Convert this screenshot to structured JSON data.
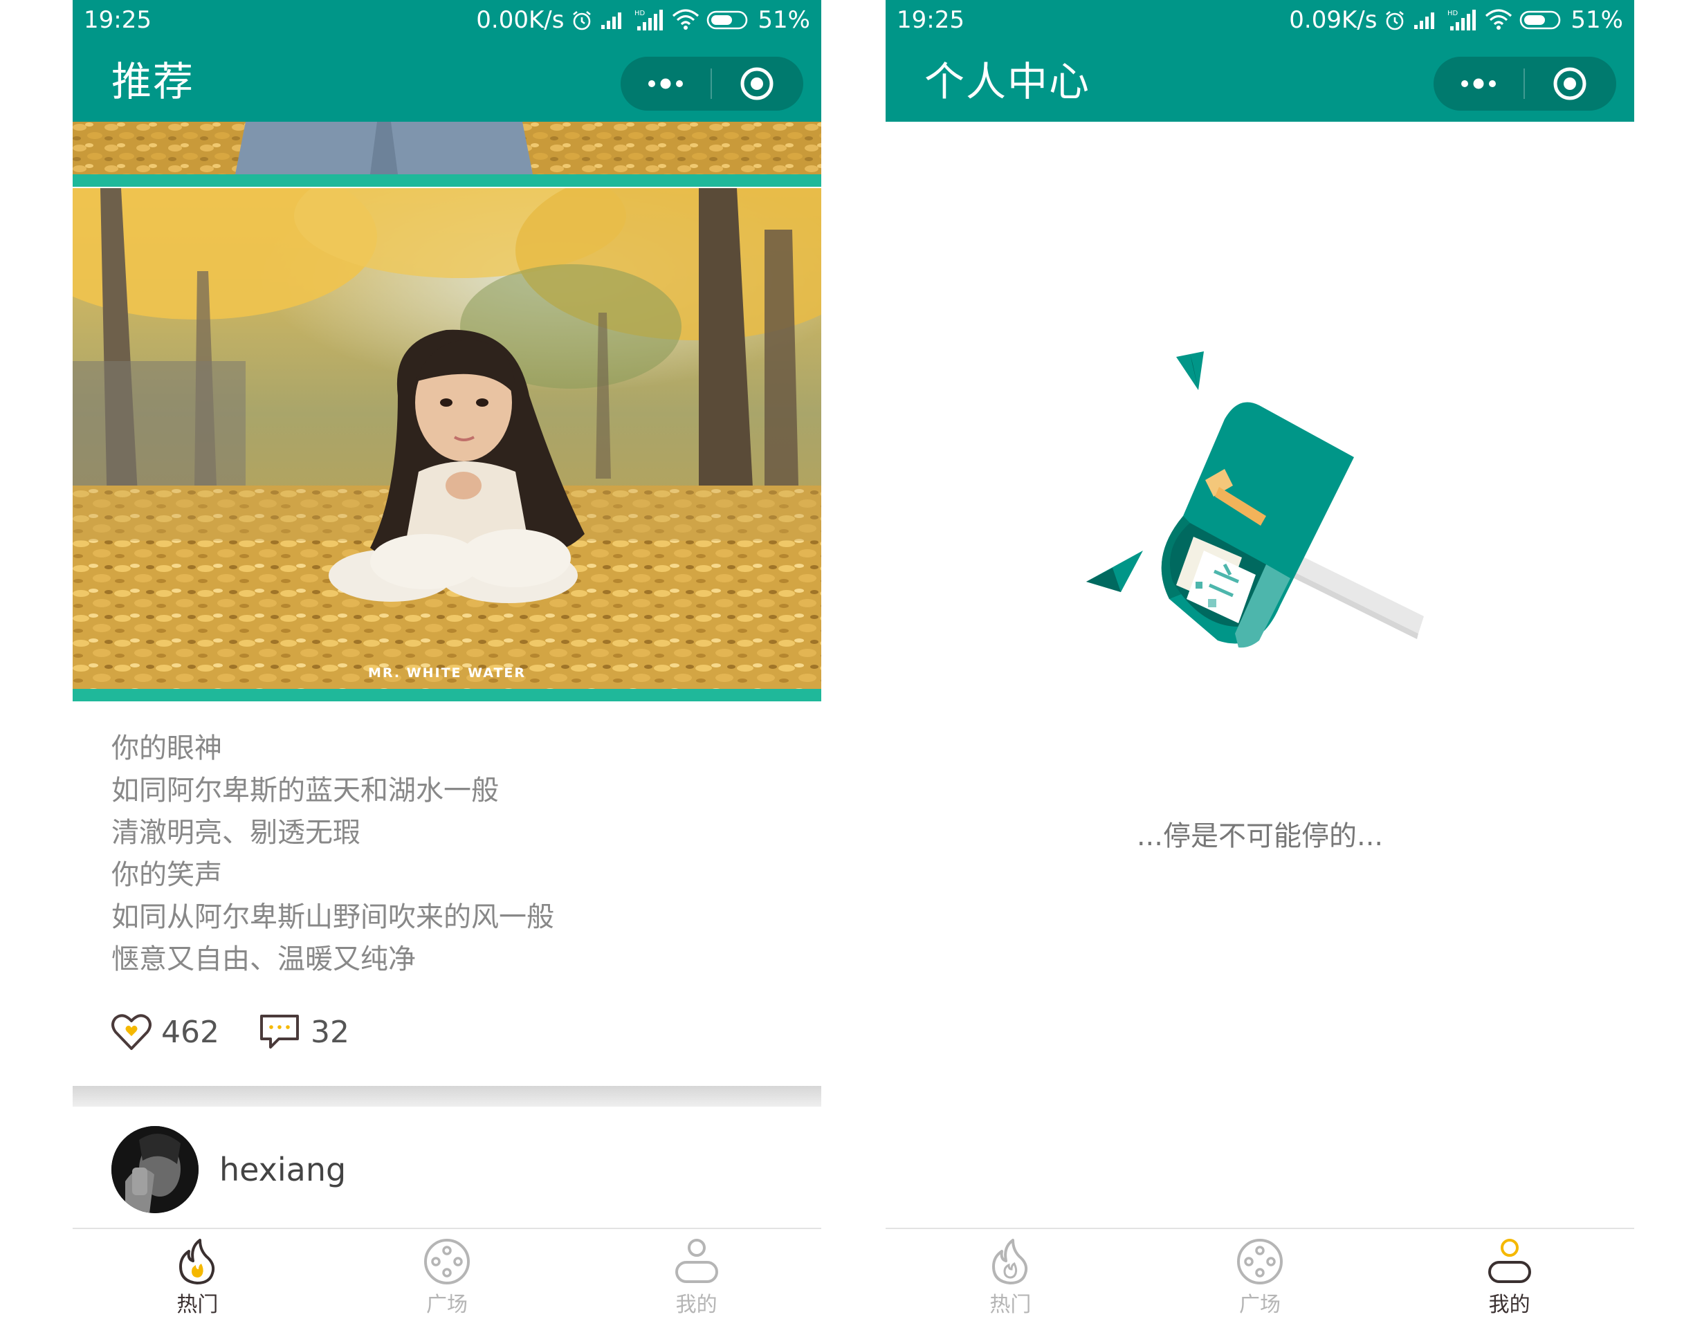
{
  "colors": {
    "primary": "#009688",
    "primary_dark": "#007a6e",
    "accent_yellow": "#f5b800",
    "tab_active": "#3a3030",
    "tab_inactive": "#b5b5b5"
  },
  "left": {
    "status": {
      "time": "19:25",
      "net_speed": "0.00K/s",
      "battery": "51%"
    },
    "nav": {
      "title": "推荐"
    },
    "post": {
      "photo_credit": "MR. WHITE WATER",
      "caption_lines": [
        "你的眼神",
        "如同阿尔卑斯的蓝天和湖水一般",
        "清澈明亮、剔透无瑕",
        "你的笑声",
        "如同从阿尔卑斯山野间吹来的风一般",
        "惬意又自由、温暖又纯净"
      ],
      "likes": "462",
      "comments": "32"
    },
    "author": {
      "name": "hexiang"
    }
  },
  "right": {
    "status": {
      "time": "19:25",
      "net_speed": "0.09K/s",
      "battery": "51%"
    },
    "nav": {
      "title": "个人中心"
    },
    "empty_text": "...停是不可能停的..."
  },
  "tabs": [
    {
      "label": "热门",
      "icon": "flame-icon"
    },
    {
      "label": "广场",
      "icon": "plaza-icon"
    },
    {
      "label": "我的",
      "icon": "user-icon"
    }
  ],
  "left_active_tab": "热门",
  "right_active_tab": "我的"
}
